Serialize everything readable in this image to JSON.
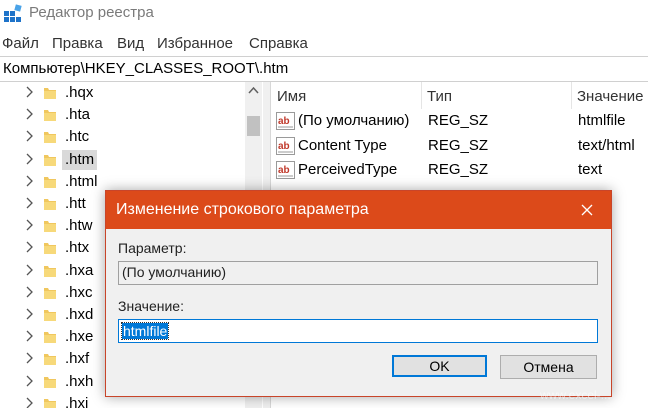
{
  "window": {
    "title": "Редактор реестра",
    "icon": "registry-editor-icon"
  },
  "menu": {
    "items": [
      "Файл",
      "Правка",
      "Вид",
      "Избранное",
      "Справка"
    ]
  },
  "address_bar": {
    "path": "Компьютер\\HKEY_CLASSES_ROOT\\.htm"
  },
  "tree": {
    "items": [
      {
        "label": ".hqx",
        "selected": false
      },
      {
        "label": ".hta",
        "selected": false
      },
      {
        "label": ".htc",
        "selected": false
      },
      {
        "label": ".htm",
        "selected": true
      },
      {
        "label": ".html",
        "selected": false
      },
      {
        "label": ".htt",
        "selected": false
      },
      {
        "label": ".htw",
        "selected": false
      },
      {
        "label": ".htx",
        "selected": false
      },
      {
        "label": ".hxa",
        "selected": false
      },
      {
        "label": ".hxc",
        "selected": false
      },
      {
        "label": ".hxd",
        "selected": false
      },
      {
        "label": ".hxe",
        "selected": false
      },
      {
        "label": ".hxf",
        "selected": false
      },
      {
        "label": ".hxh",
        "selected": false
      },
      {
        "label": ".hxi",
        "selected": false
      }
    ]
  },
  "values_list": {
    "columns": {
      "name": "Имя",
      "type": "Тип",
      "data": "Значение"
    },
    "rows": [
      {
        "name": "(По умолчанию)",
        "type": "REG_SZ",
        "data": "htmlfile"
      },
      {
        "name": "Content Type",
        "type": "REG_SZ",
        "data": "text/html"
      },
      {
        "name": "PerceivedType",
        "type": "REG_SZ",
        "data": "text"
      }
    ]
  },
  "dialog": {
    "title": "Изменение строкового параметра",
    "param_label": "Параметр:",
    "param_value": "(По умолчанию)",
    "value_label": "Значение:",
    "value_input": "htmlfile",
    "ok_label": "OK",
    "cancel_label": "Отмена"
  },
  "watermark": "www.excel-...",
  "colors": {
    "dialog_title_bg": "#dc4a1a",
    "accent": "#0078d7",
    "folder": "#f0c75e",
    "tree_selected_bg": "#d9d9d9"
  }
}
